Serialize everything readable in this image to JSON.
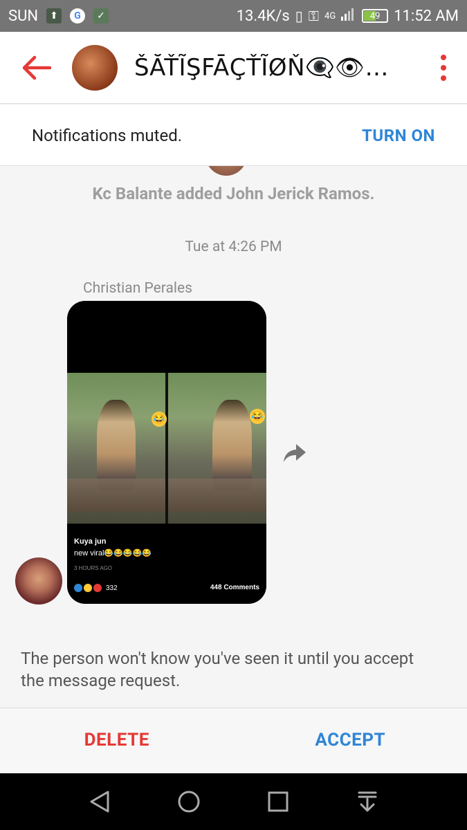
{
  "status_bar": {
    "carrier": "SUN",
    "speed": "13.4K/s",
    "network": "4G",
    "battery": "49",
    "time": "11:52 AM"
  },
  "header": {
    "title": "ŠĂŤĨŞFĀÇŤĨØŇ👁‍🗨👁👅 ..."
  },
  "mute_bar": {
    "text": "Notifications muted.",
    "action": "TURN ON"
  },
  "conversation": {
    "system_message": "Kc Balante added John Jerick Ramos.",
    "timestamp": "Tue at 4:26 PM",
    "sender_name": "Christian Perales",
    "shared_post": {
      "author": "Kuya jun",
      "text": "new viral😂😂😂😂😂",
      "time": "3 HOURS AGO",
      "reaction_count": "332",
      "comments": "448 Comments"
    }
  },
  "notice": "The person won't know you've seen it until you accept the message request.",
  "actions": {
    "delete": "DELETE",
    "accept": "ACCEPT"
  },
  "colors": {
    "accent_blue": "#2f86d6",
    "danger_red": "#e53935",
    "status_bar_bg": "#757575"
  },
  "icons": {
    "back": "arrow-left-icon",
    "menu": "more-vert-icon",
    "share": "share-icon",
    "nav_back": "triangle-back-icon",
    "nav_home": "circle-home-icon",
    "nav_recents": "square-recents-icon",
    "nav_notifications": "pull-down-icon"
  }
}
